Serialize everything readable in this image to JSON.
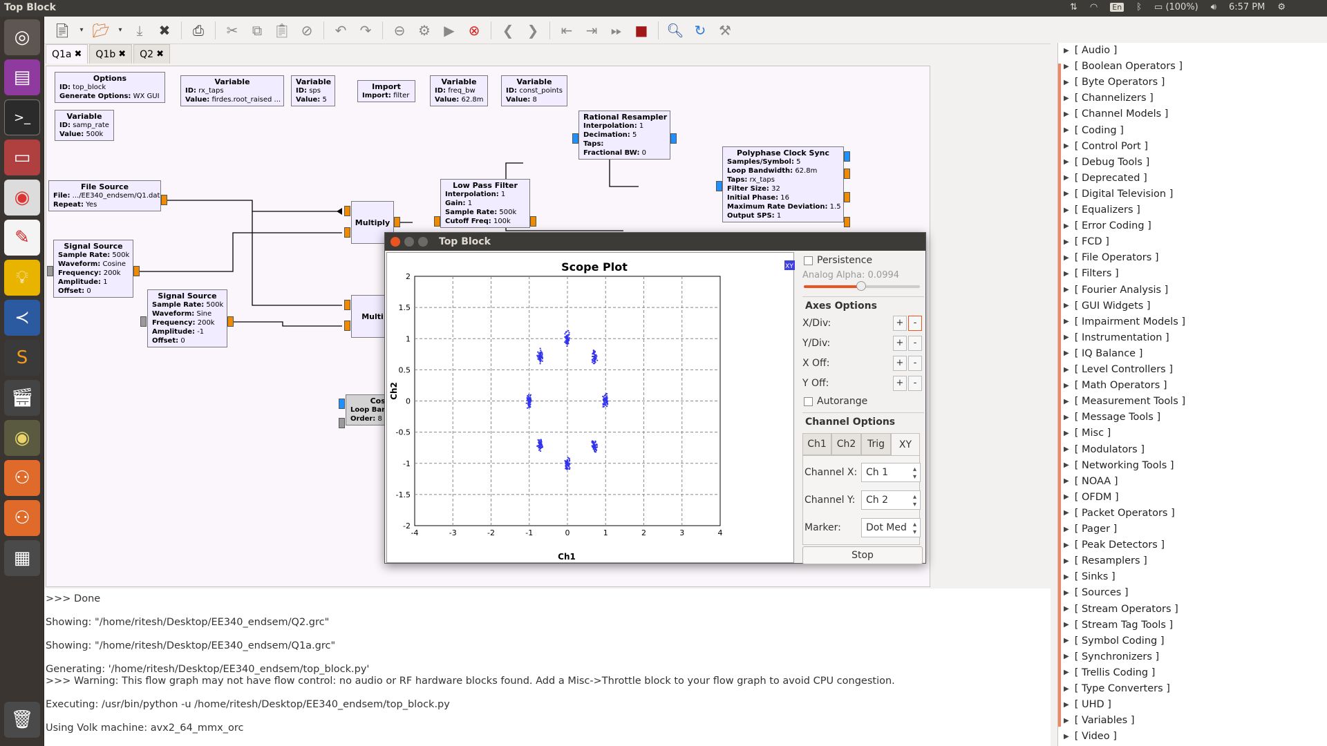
{
  "topbar": {
    "window_title": "Top Block",
    "keyboard": "En",
    "battery": "(100%)",
    "clock": "6:57 PM"
  },
  "toolbar": {
    "icons": [
      "new-icon",
      "open-icon",
      "save-icon",
      "close-icon",
      "print-icon",
      "cut-icon",
      "copy-icon",
      "paste-icon",
      "delete-icon",
      "undo-icon",
      "redo-icon",
      "disable-icon",
      "bypass-icon",
      "execute-icon",
      "kill-icon",
      "rotate-left-icon",
      "rotate-right-icon",
      "move-icon",
      "find-icon",
      "reload-icon"
    ]
  },
  "tabs": [
    {
      "label": "Q1a"
    },
    {
      "label": "Q1b"
    },
    {
      "label": "Q2"
    }
  ],
  "blocks": {
    "options": {
      "title": "Options",
      "id_k": "ID:",
      "id": "top_block",
      "gen_k": "Generate Options:",
      "gen": "WX GUI"
    },
    "var_rx": {
      "title": "Variable",
      "id_k": "ID:",
      "id": "rx_taps",
      "val_k": "Value:",
      "val": "firdes.root_raised ..."
    },
    "var_sps": {
      "title": "Variable",
      "id_k": "ID:",
      "id": "sps",
      "val_k": "Value:",
      "val": "5"
    },
    "import": {
      "title": "Import",
      "imp_k": "Import:",
      "imp": "filter"
    },
    "var_bw": {
      "title": "Variable",
      "id_k": "ID:",
      "id": "freq_bw",
      "val_k": "Value:",
      "val": "62.8m"
    },
    "var_cp": {
      "title": "Variable",
      "id_k": "ID:",
      "id": "const_points",
      "val_k": "Value:",
      "val": "8"
    },
    "var_sr": {
      "title": "Variable",
      "id_k": "ID:",
      "id": "samp_rate",
      "val_k": "Value:",
      "val": "500k"
    },
    "file_source": {
      "title": "File Source",
      "file_k": "File:",
      "file": ".../EE340_endsem/Q1.dat",
      "rep_k": "Repeat:",
      "rep": "Yes"
    },
    "sig1": {
      "title": "Signal Source",
      "sr_k": "Sample Rate:",
      "sr": "500k",
      "wf_k": "Waveform:",
      "wf": "Cosine",
      "fr_k": "Frequency:",
      "fr": "200k",
      "am_k": "Amplitude:",
      "am": "1",
      "of_k": "Offset:",
      "of": "0"
    },
    "sig2": {
      "title": "Signal Source",
      "sr_k": "Sample Rate:",
      "sr": "500k",
      "wf_k": "Waveform:",
      "wf": "Sine",
      "fr_k": "Frequency:",
      "fr": "200k",
      "am_k": "Amplitude:",
      "am": "-1",
      "of_k": "Offset:",
      "of": "0"
    },
    "mult1": {
      "title": "Multiply"
    },
    "mult2": {
      "title": "Multi"
    },
    "lpf": {
      "title": "Low Pass Filter",
      "int_k": "Interpolation:",
      "int": "1",
      "gain_k": "Gain:",
      "gain": "1",
      "sr_k": "Sample Rate:",
      "sr": "500k",
      "cf_k": "Cutoff Freq:",
      "cf": "100k"
    },
    "resampler": {
      "title": "Rational Resampler",
      "int_k": "Interpolation:",
      "int": "1",
      "dec_k": "Decimation:",
      "dec": "5",
      "taps_k": "Taps:",
      "fbw_k": "Fractional BW:",
      "fbw": "0"
    },
    "pcs": {
      "title": "Polyphase Clock Sync",
      "sps_k": "Samples/Symbol:",
      "sps": "5",
      "lbw_k": "Loop Bandwidth:",
      "lbw": "62.8m",
      "taps_k": "Taps:",
      "taps": "rx_taps",
      "fs_k": "Filter Size:",
      "fs": "32",
      "ip_k": "Initial Phase:",
      "ip": "16",
      "mrd_k": "Maximum Rate Deviation:",
      "mrd": "1.5",
      "osps_k": "Output SPS:",
      "osps": "1"
    },
    "costas": {
      "title": "Cost",
      "lb_k": "Loop Ban",
      "ord_k": "Order:",
      "ord": "8"
    }
  },
  "console": [
    ">>> Done",
    "Showing: \"/home/ritesh/Desktop/EE340_endsem/Q2.grc\"",
    "Showing: \"/home/ritesh/Desktop/EE340_endsem/Q1a.grc\"",
    "Generating: '/home/ritesh/Desktop/EE340_endsem/top_block.py'",
    ">>> Warning: This flow graph may not have flow control: no audio or RF hardware blocks found. Add a Misc->Throttle block to your flow graph to avoid CPU congestion.",
    "Executing: /usr/bin/python -u /home/ritesh/Desktop/EE340_endsem/top_block.py",
    "Using Volk machine: avx2_64_mmx_orc"
  ],
  "sidebar": [
    "[ Audio ]",
    "[ Boolean Operators ]",
    "[ Byte Operators ]",
    "[ Channelizers ]",
    "[ Channel Models ]",
    "[ Coding ]",
    "[ Control Port ]",
    "[ Debug Tools ]",
    "[ Deprecated ]",
    "[ Digital Television ]",
    "[ Equalizers ]",
    "[ Error Coding ]",
    "[ FCD ]",
    "[ File Operators ]",
    "[ Filters ]",
    "[ Fourier Analysis ]",
    "[ GUI Widgets ]",
    "[ Impairment Models ]",
    "[ Instrumentation ]",
    "[ IQ Balance ]",
    "[ Level Controllers ]",
    "[ Math Operators ]",
    "[ Measurement Tools ]",
    "[ Message Tools ]",
    "[ Misc ]",
    "[ Modulators ]",
    "[ Networking Tools ]",
    "[ NOAA ]",
    "[ OFDM ]",
    "[ Packet Operators ]",
    "[ Pager ]",
    "[ Peak Detectors ]",
    "[ Resamplers ]",
    "[ Sinks ]",
    "[ Sources ]",
    "[ Stream Operators ]",
    "[ Stream Tag Tools ]",
    "[ Symbol Coding ]",
    "[ Synchronizers ]",
    "[ Trellis Coding ]",
    "[ Type Converters ]",
    "[ UHD ]",
    "[ Variables ]",
    "[ Video ]"
  ],
  "scope": {
    "window_title": "Top Block",
    "plot_title": "Scope Plot",
    "xy_badge": "XY",
    "persistence": "Persistence",
    "analog_alpha": "Analog Alpha: 0.0994",
    "analog_alpha_value": 0.0994,
    "axes_options": "Axes Options",
    "xdiv": "X/Div:",
    "ydiv": "Y/Div:",
    "xoff": "X Off:",
    "yoff": "Y Off:",
    "plus": "+",
    "minus": "-",
    "autorange": "Autorange",
    "channel_options": "Channel Options",
    "ctabs": [
      "Ch1",
      "Ch2",
      "Trig",
      "XY"
    ],
    "channel_x_label": "Channel X:",
    "channel_x": "Ch 1",
    "channel_y_label": "Channel Y:",
    "channel_y": "Ch 2",
    "marker_label": "Marker:",
    "marker": "Dot Med",
    "stop": "Stop"
  },
  "chart_data": {
    "type": "scatter",
    "title": "Scope Plot",
    "xlabel": "Ch1",
    "ylabel": "Ch2",
    "xlim": [
      -4,
      4
    ],
    "ylim": [
      -2,
      2
    ],
    "xticks": [
      "-4",
      "-3",
      "-2",
      "-1",
      "0",
      "1",
      "2",
      "3",
      "4"
    ],
    "yticks": [
      "2",
      "1.5",
      "1",
      "0.5",
      "0",
      "-0.5",
      "-1",
      "-1.5",
      "-2"
    ],
    "grid": true,
    "color": "#3333ee",
    "clusters": [
      {
        "x": 0.0,
        "y": 1.0
      },
      {
        "x": 0.71,
        "y": 0.71
      },
      {
        "x": 1.0,
        "y": 0.0
      },
      {
        "x": 0.71,
        "y": -0.71
      },
      {
        "x": 0.0,
        "y": -1.0
      },
      {
        "x": -0.71,
        "y": -0.71
      },
      {
        "x": -1.0,
        "y": 0.0
      },
      {
        "x": -0.71,
        "y": 0.71
      }
    ]
  }
}
